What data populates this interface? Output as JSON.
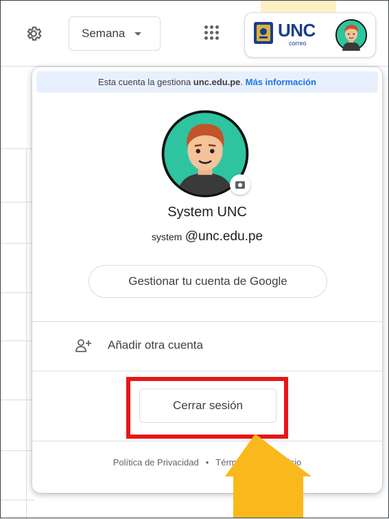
{
  "header": {
    "view_select_value": "Semana",
    "org_logo_text": "UNC",
    "org_logo_subtext": "correo"
  },
  "popup": {
    "managed_prefix": "Esta cuenta la gestiona ",
    "managed_domain": "unc.edu.pe",
    "managed_suffix": ". ",
    "more_info_link": "Más información",
    "user_name": "System UNC",
    "email_local": "system",
    "email_domain": "@unc.edu.pe",
    "manage_account_label": "Gestionar tu cuenta de Google",
    "add_account_label": "Añadir otra cuenta",
    "sign_out_label": "Cerrar sesión",
    "footer_privacy": "Política de Privacidad",
    "footer_separator": "•",
    "footer_terms": "Términos del Servicio"
  },
  "colors": {
    "highlight": "#e81616",
    "arrow": "#f9b81b",
    "link": "#1a73e8",
    "avatar_bg": "#2ec4a0"
  },
  "icons": [
    "gear-icon",
    "dropdown-caret-icon",
    "apps-grid-icon",
    "unc-logo",
    "avatar",
    "camera-icon",
    "add-person-icon"
  ]
}
